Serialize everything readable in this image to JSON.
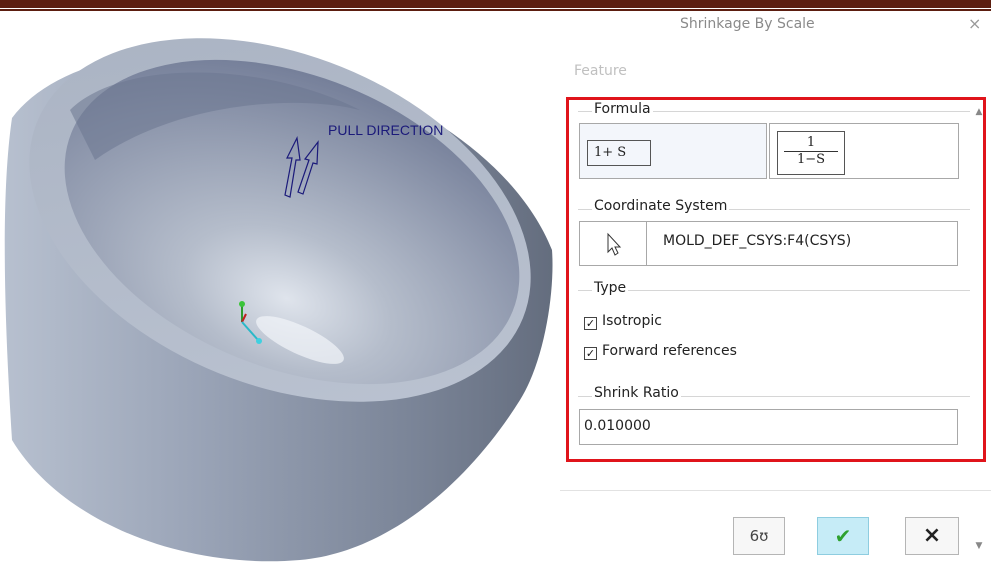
{
  "viewport": {
    "pull_direction_label": "PULL DIRECTION"
  },
  "dialog": {
    "title": "Shrinkage By Scale",
    "close_glyph": "×",
    "feature_label": "Feature",
    "formula": {
      "group_label": "Formula",
      "option_1": "1+ S",
      "option_2_numerator": "1",
      "option_2_denominator": "1−S"
    },
    "coordinate_system": {
      "group_label": "Coordinate System",
      "value": "MOLD_DEF_CSYS:F4(CSYS)",
      "selector_icon": "cursor-arrow-icon"
    },
    "type": {
      "group_label": "Type",
      "isotropic_label": "Isotropic",
      "isotropic_checked": true,
      "forward_label": "Forward references",
      "forward_checked": true
    },
    "shrink_ratio": {
      "group_label": "Shrink Ratio",
      "value": "0.010000"
    },
    "buttons": {
      "preview_glyph": "6ʊ",
      "ok_glyph": "✔",
      "cancel_glyph": "×"
    }
  },
  "colors": {
    "accent_red": "#e0141b",
    "header_bar": "#5c1e10",
    "ok_green": "#2ea12e",
    "ok_bg": "#c6ecf7",
    "model_gray": "#8e99ae"
  }
}
